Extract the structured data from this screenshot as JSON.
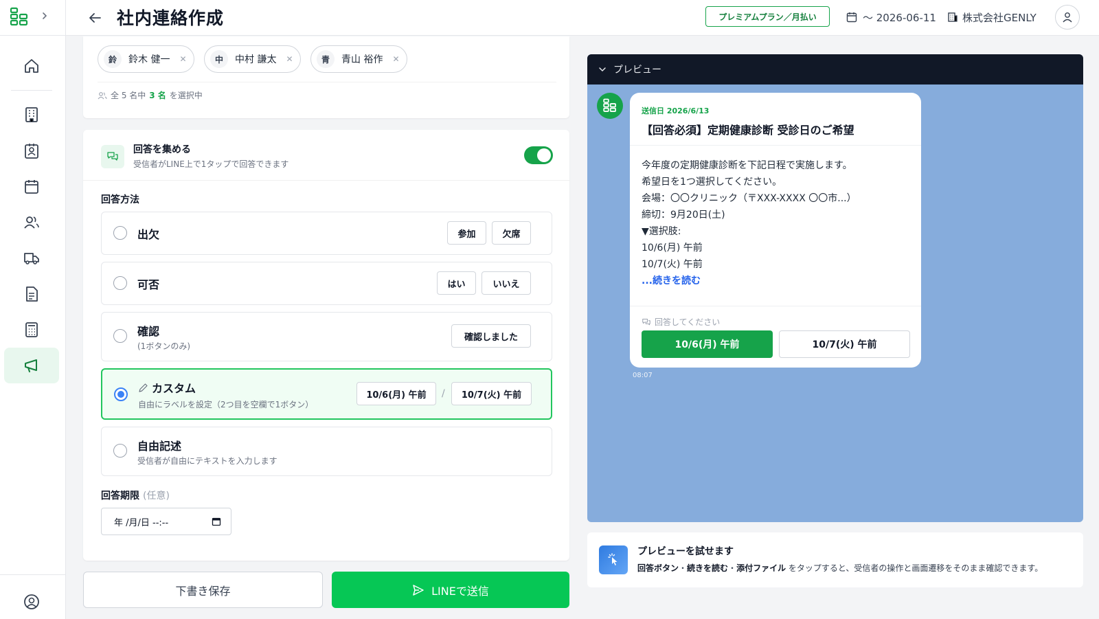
{
  "header": {
    "title": "社内連絡作成",
    "plan": "プレミアムプラン／月払い",
    "expiry": "〜 2026-06-11",
    "company": "株式会社GENLY"
  },
  "sidebar": {
    "items": [
      "home-icon",
      "building-icon",
      "contact-card-icon",
      "calendar-icon",
      "users-icon",
      "truck-icon",
      "document-icon",
      "calculator-icon",
      "megaphone-icon"
    ],
    "active": "megaphone-icon"
  },
  "recipients": {
    "chips": [
      {
        "initial": "鈴",
        "name": "鈴木 健一"
      },
      {
        "initial": "中",
        "name": "中村 謙太"
      },
      {
        "initial": "青",
        "name": "青山 裕作"
      }
    ],
    "count_prefix": "全 5 名中",
    "count_selected": "3 名",
    "count_suffix": "を選択中"
  },
  "response": {
    "title": "回答を集める",
    "subtitle": "受信者がLINE上で1タップで回答できます",
    "toggle_on": true,
    "method_label": "回答方法",
    "options": [
      {
        "title": "出欠",
        "subtitle": "",
        "buttons": [
          "参加",
          "欠席"
        ]
      },
      {
        "title": "可否",
        "subtitle": "",
        "buttons": [
          "はい",
          "いいえ"
        ]
      },
      {
        "title": "確認",
        "subtitle": "(1ボタンのみ)",
        "buttons": [
          "確認しました"
        ]
      },
      {
        "title": "カスタム",
        "subtitle": "自由にラベルを設定（2つ目を空欄で1ボタン）",
        "buttons": [
          "10/6(月) 午前",
          "10/7(火) 午前"
        ],
        "separator": "/"
      },
      {
        "title": "自由記述",
        "subtitle": "受信者が自由にテキストを入力します",
        "buttons": []
      }
    ],
    "selected_index": 3,
    "deadline_label": "回答期限",
    "deadline_optional": "(任意)",
    "deadline_value": "年 /月/日 --:--"
  },
  "actions": {
    "draft": "下書き保存",
    "send": "LINEで送信"
  },
  "preview": {
    "bar_label": "プレビュー",
    "send_date": "送信日 2026/6/13",
    "message_title": "【回答必須】定期健康診断 受診日のご希望",
    "body_lines": [
      "今年度の定期健康診断を下記日程で実施します。",
      "希望日を1つ選択してください。",
      "会場：〇〇クリニック（〒XXX-XXXX 〇〇市...）",
      "締切：9月20日(土)",
      "▼選択肢:",
      "10/6(月) 午前",
      "10/7(火) 午前"
    ],
    "read_more": "...続きを読む",
    "ask": "回答してください",
    "btn1": "10/6(月) 午前",
    "btn2": "10/7(火) 午前",
    "time": "08:07"
  },
  "hint": {
    "title": "プレビューを試せます",
    "bold1": "回答ボタン",
    "dot": "・",
    "bold2": "続きを読む",
    "bold3": "添付ファイル",
    "text": "をタップすると、受信者の操作と画面遷移をそのまま確認できます。"
  },
  "colors": {
    "brand_green": "#06c755",
    "accent_green": "#16a34a",
    "preview_bg": "#86acdc",
    "radio_blue": "#3b82f6"
  }
}
